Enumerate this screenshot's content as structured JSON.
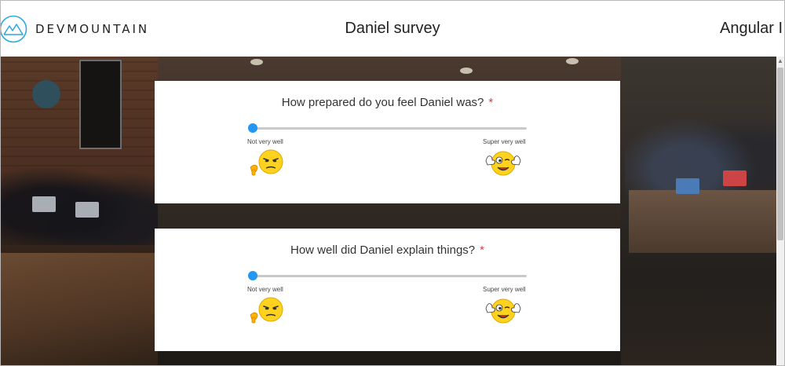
{
  "header": {
    "brand": "DEVMOUNTAIN",
    "title": "Daniel survey",
    "right_text": "Angular I"
  },
  "questions": [
    {
      "text": "How prepared do you feel Daniel was?",
      "required_mark": "*",
      "min_label": "Not very well",
      "max_label": "Super very well",
      "value_fraction": 0.0
    },
    {
      "text": "How well did Daniel explain things?",
      "required_mark": "*",
      "min_label": "Not very well",
      "max_label": "Super very well",
      "value_fraction": 0.0
    }
  ],
  "colors": {
    "accent": "#2196f3",
    "required": "#e53935",
    "brand_mark": "#2aa8e0"
  },
  "icons": {
    "brand": "mountain-logo-icon",
    "min_emoji": "annoyed-thumbs-down-emoji-icon",
    "max_emoji": "winking-thumbs-up-emoji-icon"
  }
}
